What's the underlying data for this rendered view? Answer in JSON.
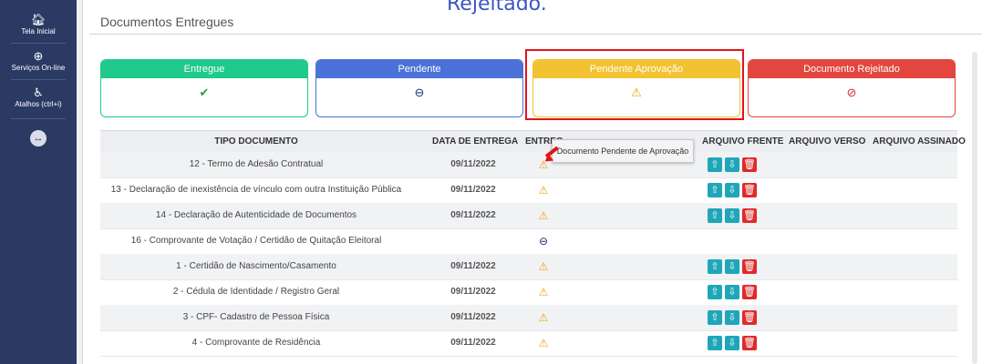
{
  "overlay": {
    "caption": "Rejeitado."
  },
  "sidebar": {
    "items": [
      {
        "label": "Tela Inicial",
        "icon": "home-icon"
      },
      {
        "label": "Serviços On-line",
        "icon": "globe-icon"
      },
      {
        "label": "Atalhos (ctrl+i)",
        "icon": "accessibility-icon"
      }
    ],
    "toggle_icon": "arrows-horizontal-icon"
  },
  "page": {
    "title": "Documentos Entregues"
  },
  "cards": [
    {
      "label": "Entregue",
      "color": "#20c98c",
      "icon": "check-icon",
      "glyph": "✔"
    },
    {
      "label": "Pendente",
      "color": "#4a72d9",
      "icon": "minus-circle-icon",
      "glyph": "⊖"
    },
    {
      "label": "Pendente Aprovação",
      "color": "#f2c230",
      "icon": "warning-icon",
      "glyph": "⚠"
    },
    {
      "label": "Documento Rejeitado",
      "color": "#e3463e",
      "icon": "ban-icon",
      "glyph": "⊘"
    }
  ],
  "table": {
    "headers": [
      "TIPO DOCUMENTO",
      "DATA DE ENTREGA",
      "ENTREG",
      "ARQUIVO FRENTE",
      "ARQUIVO VERSO",
      "ARQUIVO ASSINADO"
    ],
    "rows": [
      {
        "doc": "12 - Termo de Adesão Contratual",
        "date": "09/11/2022",
        "status": "warning",
        "glyph": "⚠"
      },
      {
        "doc": "13 - Declaração de inexistência de vínculo com outra Instituição Pública",
        "date": "09/11/2022",
        "status": "warning",
        "glyph": "⚠"
      },
      {
        "doc": "14 - Declaração de Autenticidade de Documentos",
        "date": "09/11/2022",
        "status": "warning",
        "glyph": "⚠"
      },
      {
        "doc": "16 - Comprovante de Votação / Certidão de Quitação Eleitoral",
        "date": "",
        "status": "pending",
        "glyph": "⊖"
      },
      {
        "doc": "1 - Certidão de Nascimento/Casamento",
        "date": "09/11/2022",
        "status": "warning",
        "glyph": "⚠"
      },
      {
        "doc": "2 - Cédula de Identidade / Registro Geral",
        "date": "09/11/2022",
        "status": "warning",
        "glyph": "⚠"
      },
      {
        "doc": "3 - CPF- Cadastro de Pessoa Física",
        "date": "09/11/2022",
        "status": "warning",
        "glyph": "⚠"
      },
      {
        "doc": "4 - Comprovante de Residência",
        "date": "09/11/2022",
        "status": "warning",
        "glyph": "⚠"
      }
    ],
    "buttons": {
      "upload_icon": "upload-icon",
      "download_icon": "download-icon",
      "delete_icon": "trash-icon"
    }
  },
  "tooltip": {
    "text": "Documento Pendente de Aprovação"
  }
}
